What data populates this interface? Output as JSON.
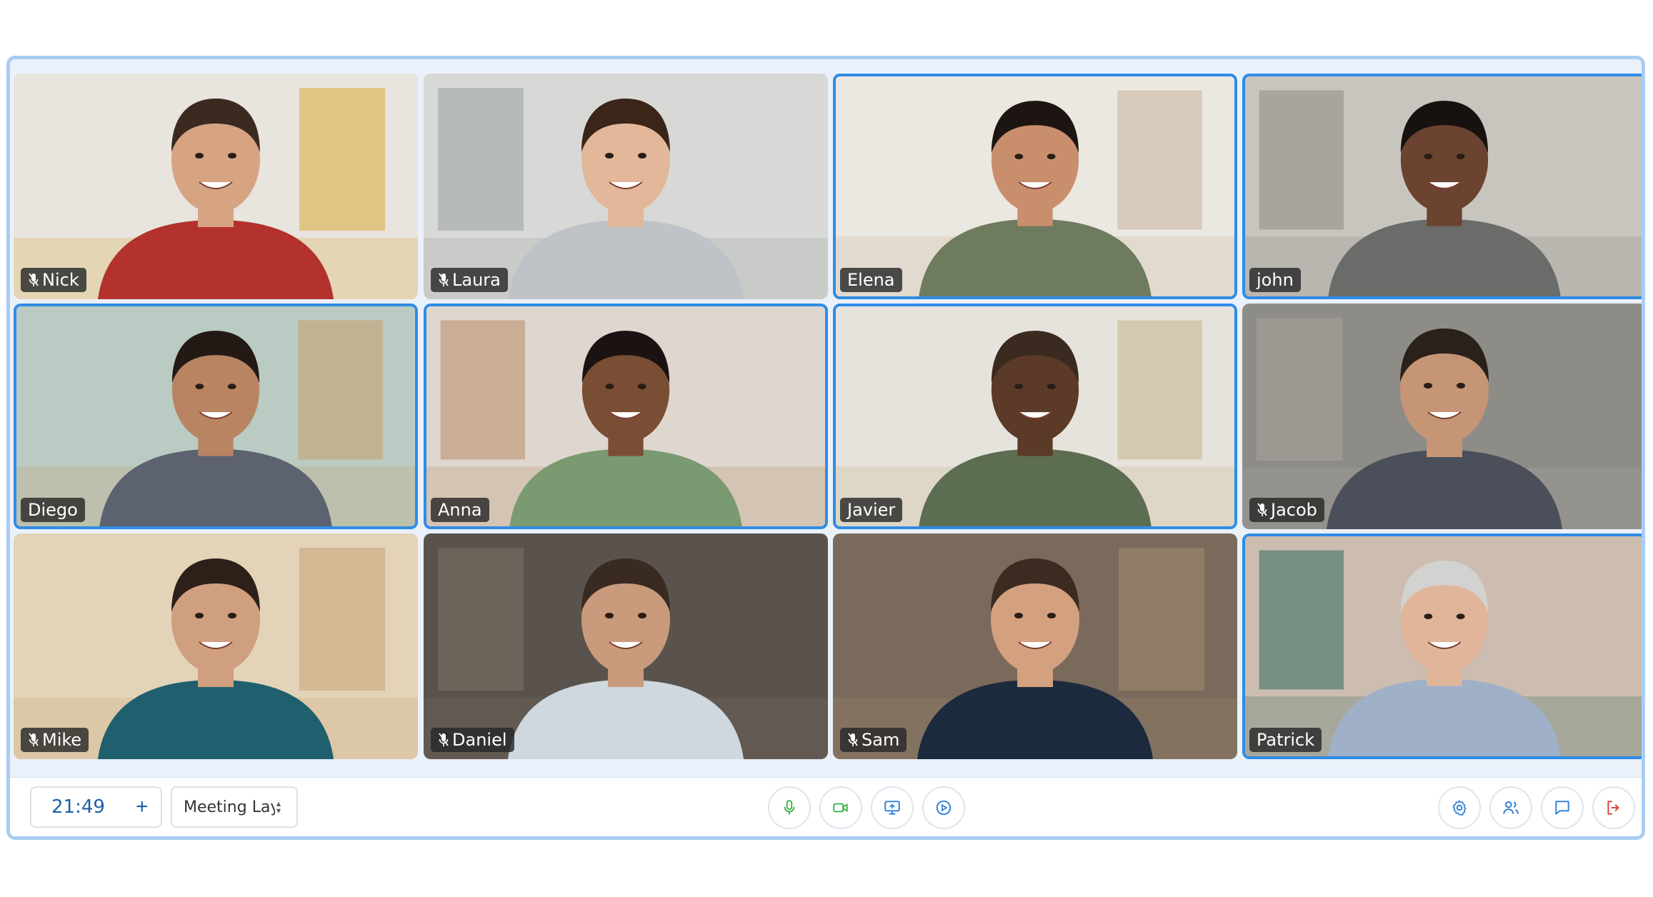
{
  "participants": [
    {
      "name": "Nick",
      "muted": true,
      "speaking": false
    },
    {
      "name": "Laura",
      "muted": true,
      "speaking": false
    },
    {
      "name": "Elena",
      "muted": false,
      "speaking": true
    },
    {
      "name": "john",
      "muted": false,
      "speaking": true
    },
    {
      "name": "Diego",
      "muted": false,
      "speaking": true
    },
    {
      "name": "Anna",
      "muted": false,
      "speaking": true
    },
    {
      "name": "Javier",
      "muted": false,
      "speaking": true
    },
    {
      "name": "Jacob",
      "muted": true,
      "speaking": false
    },
    {
      "name": "Mike",
      "muted": true,
      "speaking": false
    },
    {
      "name": "Daniel",
      "muted": true,
      "speaking": false
    },
    {
      "name": "Sam",
      "muted": true,
      "speaking": false
    },
    {
      "name": "Patrick",
      "muted": false,
      "speaking": true
    }
  ],
  "toolbar": {
    "timer": "21:49",
    "add_time_label": "+",
    "layout_select_value": "Meeting Layc",
    "left_controls": [
      {
        "icon": "microphone-icon",
        "color": "#3bb54a"
      },
      {
        "icon": "camera-icon",
        "color": "#3bb54a"
      },
      {
        "icon": "screen-share-icon",
        "color": "#2f7fd8"
      },
      {
        "icon": "record-icon",
        "color": "#2f7fd8"
      }
    ],
    "right_controls": [
      {
        "icon": "settings-icon",
        "color": "#2f7fd8"
      },
      {
        "icon": "participants-icon",
        "color": "#2f7fd8"
      },
      {
        "icon": "chat-icon",
        "color": "#2f7fd8"
      },
      {
        "icon": "leave-icon",
        "color": "#e0413a"
      }
    ]
  },
  "colors": {
    "accent": "#2f8ce6",
    "frame": "#a8cdf3",
    "background": "#eaf1fb"
  }
}
